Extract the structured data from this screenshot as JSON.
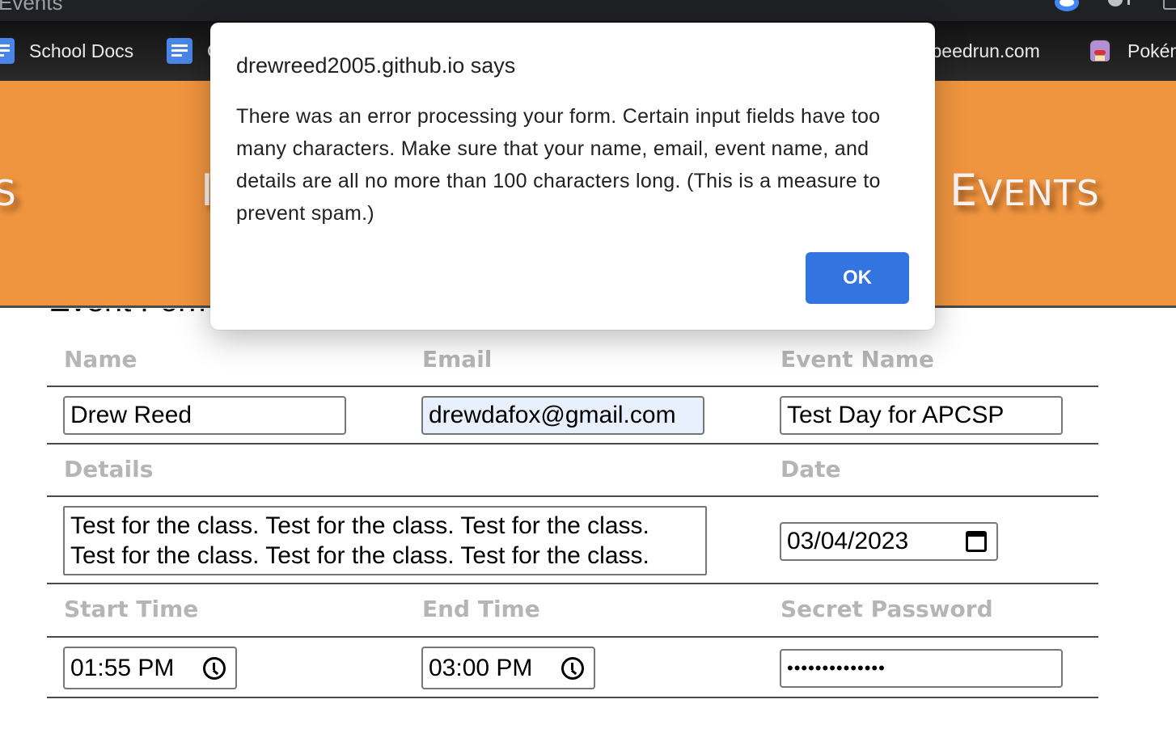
{
  "browser": {
    "tab_title": "Events",
    "bookmarks": [
      {
        "label": "School Docs",
        "icon": "google-docs-icon"
      },
      {
        "label": "C",
        "icon": "google-docs-icon"
      },
      {
        "label": "speedrun.com",
        "icon": ""
      },
      {
        "label": "Pokém",
        "icon": "pokemon-sprite-icon"
      }
    ]
  },
  "hero": {
    "left_fragment_cap": "",
    "left_fragment_rest": "TS",
    "mid_fragment": "I",
    "right_cap": "E",
    "right_rest": "VENTS"
  },
  "form": {
    "heading": "Event Form",
    "labels": {
      "name": "Name",
      "email": "Email",
      "event_name": "Event Name",
      "details": "Details",
      "date": "Date",
      "start_time": "Start Time",
      "end_time": "End Time",
      "secret_password": "Secret Password"
    },
    "values": {
      "name": "Drew Reed",
      "email": "drewdafox@gmail.com",
      "event_name": "Test Day for APCSP",
      "details_line1": "Test for the class. Test for the class. Test for the class.",
      "details_line2": "Test for the class. Test for the class. Test for the class.",
      "date": "03/04/2023",
      "start_time": "01:55 PM",
      "end_time": "03:00 PM",
      "secret_password_masked": "••••••••••••••"
    }
  },
  "dialog": {
    "title": "drewreed2005.github.io says",
    "message": "There was an error processing your form. Certain input fields have too many characters. Make sure that your name, email, event name, and details are all no more than 100 characters long. (This is a measure to prevent spam.)",
    "ok_label": "OK"
  },
  "colors": {
    "hero_orange": "#f0953f",
    "ok_button_blue": "#3474e0",
    "label_gray": "#b5b5b5",
    "autofill_blue": "#e8f0fe"
  }
}
